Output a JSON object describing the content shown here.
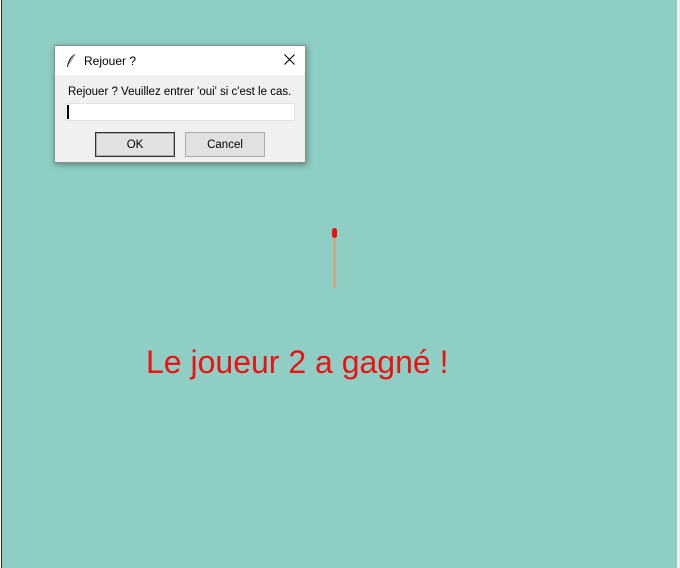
{
  "dialog": {
    "title": "Rejouer ?",
    "app_icon": "feather-icon",
    "close_icon": "close-icon",
    "prompt": "Rejouer ? Veuillez entrer 'oui' si c'est le cas.",
    "input_value": "",
    "ok_label": "OK",
    "cancel_label": "Cancel"
  },
  "game": {
    "winner_message": "Le joueur 2 a gagné !",
    "winner_color": "#ee1111",
    "background_color": "#8ecec4",
    "match_head_color": "#e81010",
    "match_stick_color": "#c9a98a",
    "matches_remaining": 1
  }
}
